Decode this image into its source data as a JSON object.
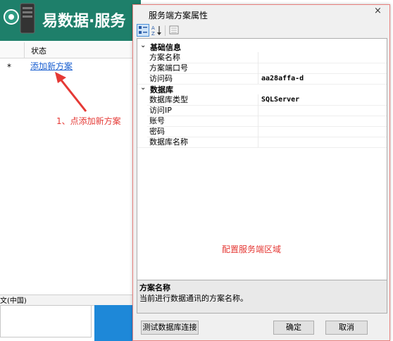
{
  "app": {
    "title": "易数据·服务",
    "table": {
      "column_status": "状态",
      "new_row_marker": "*",
      "add_plan_link": "添加新方案"
    },
    "status_bar": "文(中国)",
    "annotation_add": "1、点添加新方案"
  },
  "dialog": {
    "title": "服务端方案属性",
    "close_glyph": "×",
    "categories": [
      {
        "label": "基础信息",
        "properties": [
          {
            "name": "方案名称",
            "value": ""
          },
          {
            "name": "方案端口号",
            "value": ""
          },
          {
            "name": "访问码",
            "value": "aa28affa-d"
          }
        ]
      },
      {
        "label": "数据库",
        "properties": [
          {
            "name": "数据库类型",
            "value": "SQLServer"
          },
          {
            "name": "访问IP",
            "value": ""
          },
          {
            "name": "账号",
            "value": ""
          },
          {
            "name": "密码",
            "value": ""
          },
          {
            "name": "数据库名称",
            "value": ""
          }
        ]
      }
    ],
    "annotation_area": "配置服务端区域",
    "description": {
      "title": "方案名称",
      "text": "当前进行数据通讯的方案名称。"
    },
    "buttons": {
      "test": "测试数据库连接",
      "ok": "确定",
      "cancel": "取消"
    },
    "colors": {
      "annotation": "#e53935",
      "border": "#e8807d",
      "header_green": "#1e7f6a"
    }
  }
}
